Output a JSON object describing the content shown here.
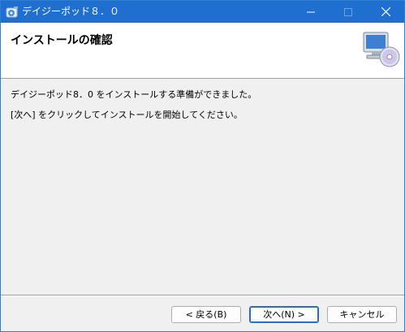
{
  "window": {
    "title": "デイジーポッド８．０",
    "accent_color": "#1f6fd0",
    "icon": "installer-app-icon"
  },
  "controls": {
    "minimize_icon": "minimize-icon",
    "maximize_icon": "maximize-icon",
    "close_icon": "close-icon"
  },
  "header": {
    "title": "インストールの確認",
    "icon": "computer-disc-icon"
  },
  "content": {
    "line1": "デイジーポッド8．0 をインストールする準備ができました。",
    "line2": "[次へ] をクリックしてインストールを開始してください。"
  },
  "buttons": {
    "back": "< 戻る(B)",
    "next": "次へ(N) >",
    "cancel": "キャンセル"
  }
}
